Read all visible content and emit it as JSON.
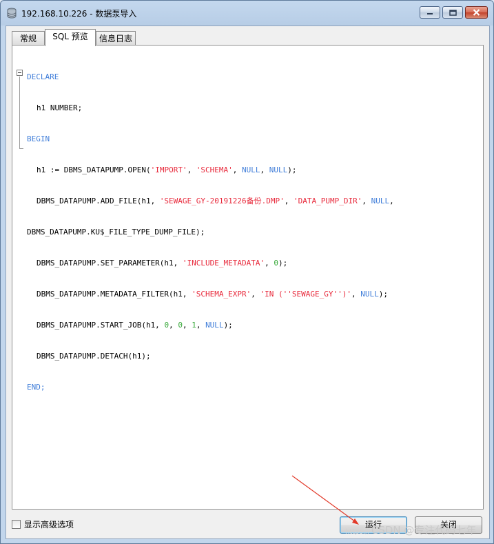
{
  "window": {
    "title": "192.168.10.226 - 数据泵导入"
  },
  "tabs": {
    "general": "常规",
    "sql_preview": "SQL 预览",
    "info_log": "信息日志"
  },
  "sql": {
    "l1": "DECLARE",
    "l2": "h1 NUMBER;",
    "l3": "BEGIN",
    "l4a": "h1 := DBMS_DATAPUMP.OPEN(",
    "l4s1": "'IMPORT'",
    "l4s2": "'SCHEMA'",
    "l4k1": "NULL",
    "l4k2": "NULL",
    "l4e": ");",
    "l5a": "DBMS_DATAPUMP.ADD_FILE(h1, ",
    "l5s1": "'SEWAGE_GY-20191226备份.DMP'",
    "l5s2": "'DATA_PUMP_DIR'",
    "l5k": "NULL",
    "l5e": ",",
    "l6": "DBMS_DATAPUMP.KU$_FILE_TYPE_DUMP_FILE);",
    "l7a": "DBMS_DATAPUMP.SET_PARAMETER(h1, ",
    "l7s": "'INCLUDE_METADATA'",
    "l7n": "0",
    "l7e": ");",
    "l8a": "DBMS_DATAPUMP.METADATA_FILTER(h1, ",
    "l8s1": "'SCHEMA_EXPR'",
    "l8s2": "'IN (''SEWAGE_GY'')'",
    "l8k": "NULL",
    "l8e": ");",
    "l9a": "DBMS_DATAPUMP.START_JOB(h1, ",
    "l9n1": "0",
    "l9n2": "0",
    "l9n3": "1",
    "l9k": "NULL",
    "l9e": ");",
    "l10": "DBMS_DATAPUMP.DETACH(h1);",
    "l11": "END;"
  },
  "footer": {
    "show_advanced": "显示高级选项",
    "run": "运行",
    "close": "关闭"
  },
  "watermark": {
    "small": "https://",
    "text": "CSDN @专注代码七年"
  },
  "colors": {
    "keyword": "#3f7dd9",
    "string": "#e8283a",
    "number": "#36a838",
    "accent": "#3c7fb1"
  }
}
